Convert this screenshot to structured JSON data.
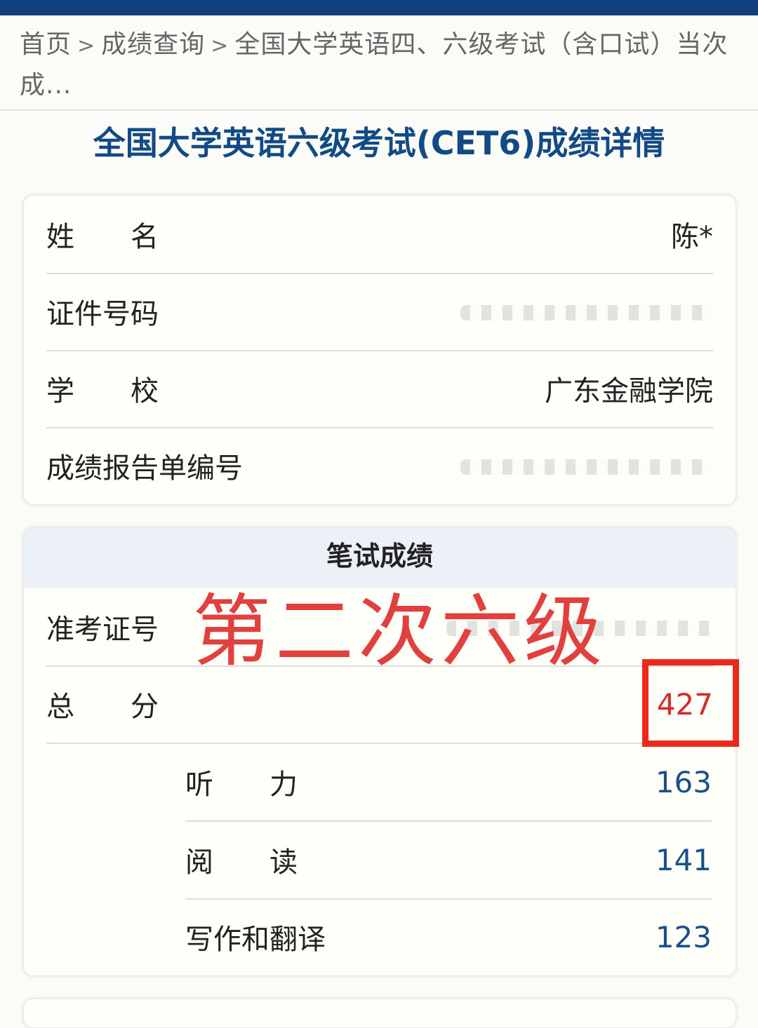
{
  "breadcrumb": {
    "items": [
      "首页",
      "成绩查询",
      "全国大学英语四、六级考试（含口试）当次成..."
    ],
    "separator": ">"
  },
  "page_title": "全国大学英语六级考试(CET6)成绩详情",
  "candidate_info": {
    "name_label": "姓　　名",
    "name_value": "陈*",
    "id_label": "证件号码",
    "school_label": "学　　校",
    "school_value": "广东金融学院",
    "report_label": "成绩报告单编号"
  },
  "written_scores": {
    "header": "笔试成绩",
    "ticket_label": "准考证号",
    "total_label": "总　　分",
    "total_value": "427",
    "listening_label": "听　　力",
    "listening_value": "163",
    "reading_label": "阅　　读",
    "reading_value": "141",
    "writing_label": "写作和翻译",
    "writing_value": "123"
  },
  "annotation": {
    "overlay_text": "第二次六级",
    "overlay_color": "#e0413e",
    "box_color": "#ec2a1c"
  },
  "colors": {
    "topbar": "#0f3f7e",
    "title": "#124a86",
    "score_blue": "#1a4f8a",
    "score_red": "#d42a2a"
  }
}
